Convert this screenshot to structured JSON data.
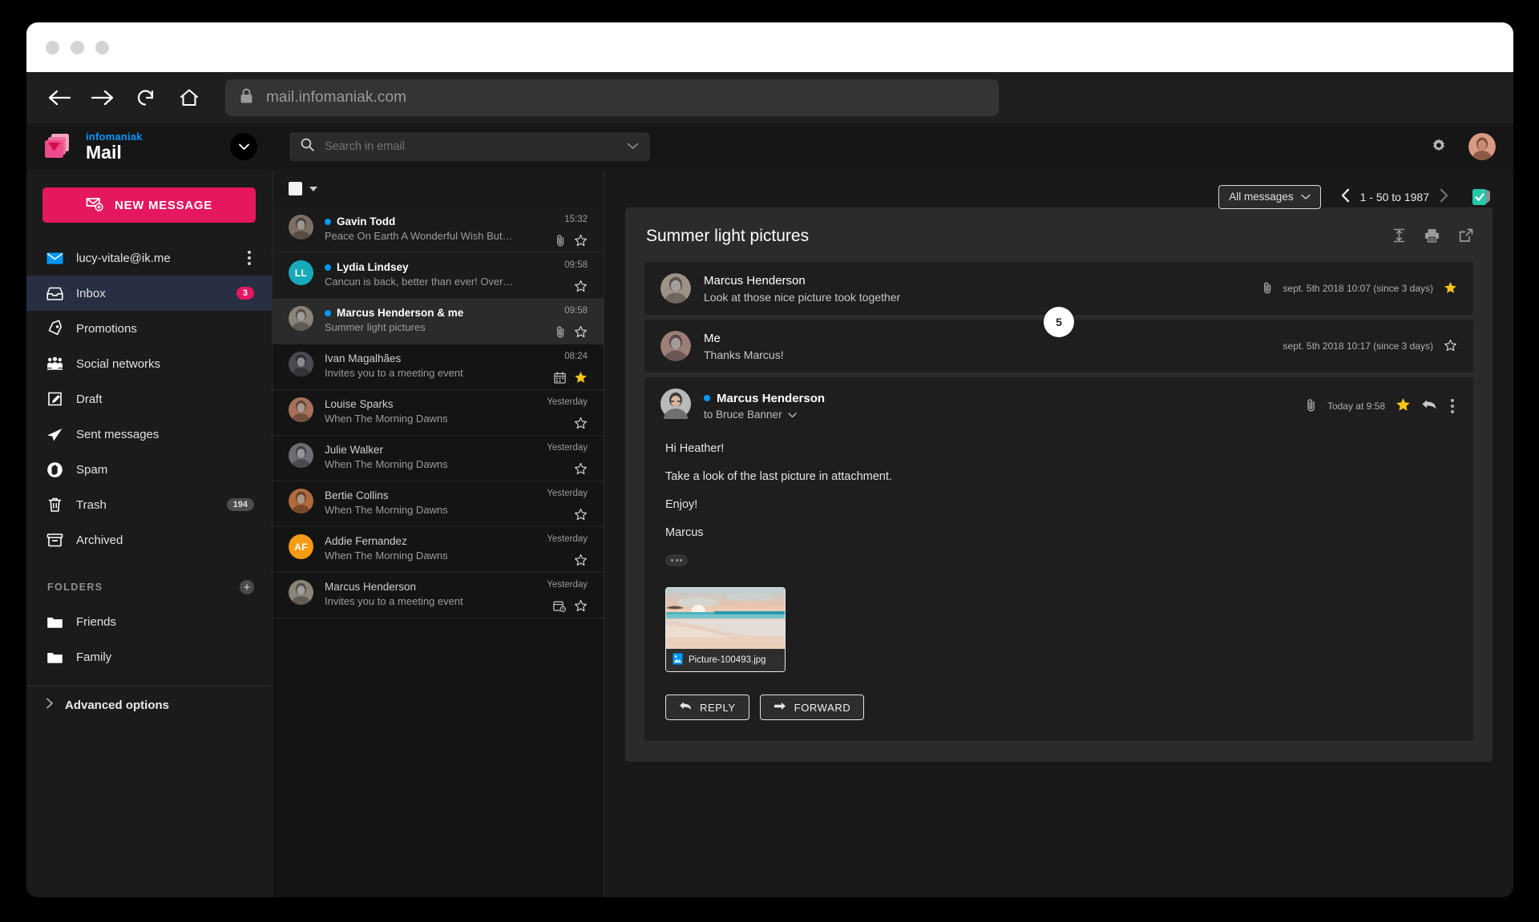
{
  "browser": {
    "url": "mail.infomaniak.com",
    "back_label": "Back",
    "forward_label": "Forward",
    "reload_label": "Reload",
    "home_label": "Home"
  },
  "brand": {
    "top": "infomaniak",
    "name": "Mail"
  },
  "sidebar": {
    "new_message": "NEW MESSAGE",
    "account": "lucy-vitale@ik.me",
    "items": [
      {
        "label": "Inbox",
        "icon": "inbox-icon",
        "badge": "3",
        "active": true
      },
      {
        "label": "Promotions",
        "icon": "tag-icon",
        "badge": ""
      },
      {
        "label": "Social networks",
        "icon": "people-icon",
        "badge": ""
      },
      {
        "label": "Draft",
        "icon": "draft-icon",
        "badge": ""
      },
      {
        "label": "Sent messages",
        "icon": "send-icon",
        "badge": ""
      },
      {
        "label": "Spam",
        "icon": "spam-icon",
        "badge": ""
      },
      {
        "label": "Trash",
        "icon": "trash-icon",
        "badge": "194"
      },
      {
        "label": "Archived",
        "icon": "archive-icon",
        "badge": ""
      }
    ],
    "folders_title": "FOLDERS",
    "folders": [
      {
        "label": "Friends"
      },
      {
        "label": "Family"
      }
    ],
    "advanced": "Advanced options"
  },
  "search": {
    "placeholder": "Search in email"
  },
  "listtoolbar": {
    "filter_label": "All messages",
    "range": "1 - 50 to 1987"
  },
  "mails": [
    {
      "from": "Gavin Todd",
      "subject": "Peace On Earth A Wonderful Wish But No Way…",
      "time": "15:32",
      "unread": true,
      "attach": true,
      "starred": false,
      "calendar": false,
      "avatar_type": "photo",
      "avatar_color": "#7d6f63",
      "initials": ""
    },
    {
      "from": "Lydia Lindsey",
      "subject": "Cancun is back, better than ever! Over a hundred…",
      "time": "09:58",
      "unread": true,
      "attach": false,
      "starred": false,
      "calendar": false,
      "avatar_type": "initials",
      "avatar_color": "#17aab8",
      "initials": "LL"
    },
    {
      "from": "Marcus Henderson & me",
      "subject": "Summer light pictures",
      "time": "09:58",
      "unread": true,
      "attach": true,
      "starred": false,
      "calendar": false,
      "selected": true,
      "avatar_type": "photo",
      "avatar_color": "#8a8377",
      "initials": ""
    },
    {
      "from": "Ivan Magalhães",
      "subject": "Invites you to a meeting event",
      "time": "08:24",
      "unread": false,
      "attach": false,
      "starred": true,
      "calendar": true,
      "avatar_type": "photo",
      "avatar_color": "#4b4a52",
      "initials": ""
    },
    {
      "from": "Louise Sparks",
      "subject": "When The Morning Dawns",
      "time": "Yesterday",
      "unread": false,
      "attach": false,
      "starred": false,
      "calendar": false,
      "avatar_type": "photo",
      "avatar_color": "#a8715a",
      "initials": ""
    },
    {
      "from": "Julie Walker",
      "subject": "When The Morning Dawns",
      "time": "Yesterday",
      "unread": false,
      "attach": false,
      "starred": false,
      "calendar": false,
      "avatar_type": "photo",
      "avatar_color": "#6c6c72",
      "initials": ""
    },
    {
      "from": "Bertie Collins",
      "subject": "When The Morning Dawns",
      "time": "Yesterday",
      "unread": false,
      "attach": false,
      "starred": false,
      "calendar": false,
      "avatar_type": "photo",
      "avatar_color": "#b06a3c",
      "initials": ""
    },
    {
      "from": "Addie Fernandez",
      "subject": "When The Morning Dawns",
      "time": "Yesterday",
      "unread": false,
      "attach": false,
      "starred": false,
      "calendar": false,
      "avatar_type": "initials",
      "avatar_color": "#f59b16",
      "initials": "AF"
    },
    {
      "from": "Marcus Henderson",
      "subject": "Invites you to a meeting event",
      "time": "Yesterday",
      "unread": false,
      "attach": false,
      "starred": false,
      "calendar": true,
      "avatar_type": "photo",
      "avatar_color": "#8a8377",
      "initials": ""
    }
  ],
  "thread": {
    "subject": "Summer light pictures",
    "counter": "5",
    "collapsed": [
      {
        "name": "Marcus Henderson",
        "snippet": "Look at those nice picture took together",
        "date": "sept. 5th 2018 10:07 (since 3 days)",
        "attach": true,
        "starred": true,
        "unread": false
      },
      {
        "name": "Me",
        "snippet": "Thanks Marcus!",
        "date": "sept. 5th 2018 10:17 (since 3 days)",
        "attach": false,
        "starred": false,
        "unread": false
      }
    ],
    "open": {
      "name": "Marcus Henderson",
      "to": "to Bruce Banner",
      "date": "Today at 9:58",
      "attach": true,
      "starred": true,
      "unread": true,
      "body": [
        "Hi Heather!",
        "Take a look of the last picture in attachment.",
        "Enjoy!",
        "Marcus"
      ],
      "attachment": {
        "filename": "Picture-100493.jpg"
      },
      "reply_label": "REPLY",
      "forward_label": "FORWARD"
    }
  },
  "colors": {
    "accent_pink": "#e5175e",
    "accent_blue": "#0098ff",
    "star_yellow": "#f5c518",
    "active_row": "#282f42",
    "teal_badge": "#21c1a5"
  }
}
